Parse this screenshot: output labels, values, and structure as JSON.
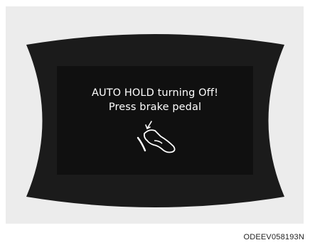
{
  "display": {
    "message_line1": "AUTO HOLD turning Off!",
    "message_line2": "Press brake pedal",
    "icon": "foot-on-brake-pedal-icon",
    "background_color": "#1b1b1b",
    "text_color": "#ffffff"
  },
  "figure": {
    "code": "ODEEV058193N"
  }
}
